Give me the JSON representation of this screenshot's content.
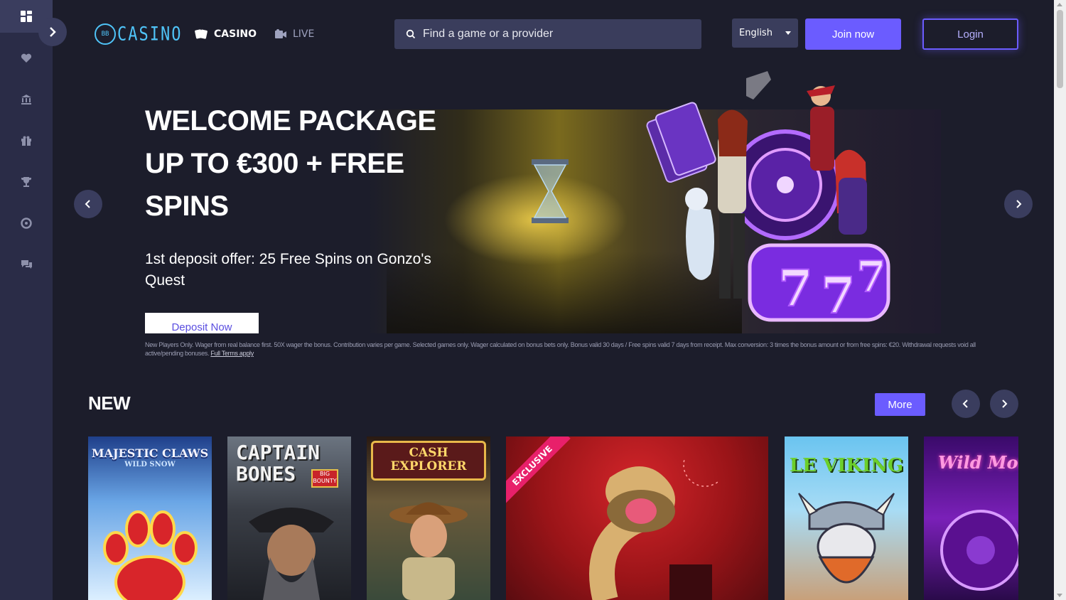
{
  "header": {
    "logo_badge": "BB",
    "logo_text": "CASINO",
    "nav": [
      {
        "label": "CASINO",
        "icon": "cards-icon"
      },
      {
        "label": "LIVE",
        "icon": "live-icon"
      }
    ],
    "search_placeholder": "Find a game or a provider",
    "language": "English",
    "join_label": "Join now",
    "login_label": "Login"
  },
  "sidebar": {
    "items": [
      "dashboard-icon",
      "heart-icon",
      "bank-icon",
      "gift-icon",
      "trophy-icon",
      "lifebuoy-icon",
      "chat-icon"
    ]
  },
  "hero": {
    "title": "WELCOME PACKAGE UP TO €300 + FREE SPINS",
    "subtitle": "1st deposit offer: 25 Free Spins on Gonzo's Quest",
    "cta": "Deposit Now",
    "terms": "New Players Only. Wager from real balance first. 50X wager the bonus. Contribution varies per game. Selected games only. Wager calculated on bonus bets only. Bonus valid 30 days / Free spins valid 7 days from receipt. Max conversion: 3 times the bonus amount or from free spins: €20. Withdrawal requests void all active/pending bonuses.",
    "terms_link": "Full Terms apply"
  },
  "new_section": {
    "title": "NEW",
    "more_label": "More",
    "games": [
      {
        "title": "MAJESTIC CLAWS",
        "subtitle": "WILD SNOW"
      },
      {
        "title": "CAPTAIN BONES",
        "badge": "BIG BOUNTY"
      },
      {
        "title": "CASH EXPLORER"
      },
      {
        "title": "",
        "badge": "EXCLUSIVE"
      },
      {
        "title": "LE VIKING"
      },
      {
        "title": "Wild Mon VEGAS"
      }
    ]
  },
  "colors": {
    "background": "#1c1d2b",
    "sidebar": "#2a2c47",
    "accent": "#6b5cff",
    "logo": "#4fc3f7"
  }
}
